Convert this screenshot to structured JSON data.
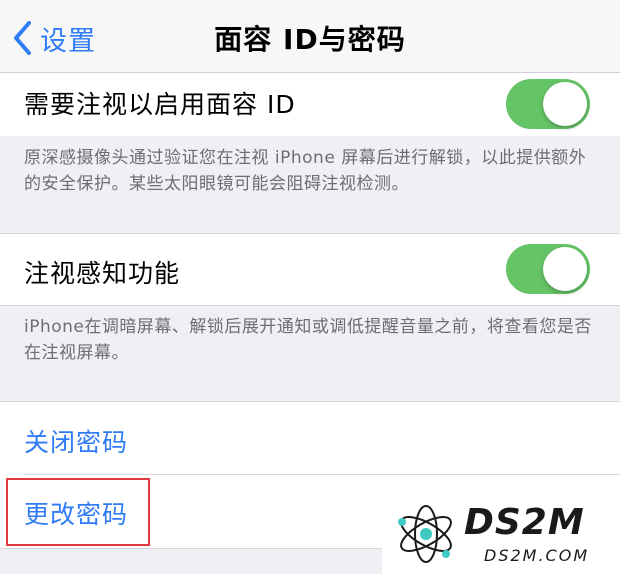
{
  "nav": {
    "back_label": "设置",
    "title": "面容 ID与密码"
  },
  "attention_row": {
    "label": "需要注视以启用面容 ID",
    "toggle_on": true,
    "footer": "原深感摄像头通过验证您在注视 iPhone 屏幕后进行解锁，以此提供额外的安全保护。某些太阳眼镜可能会阻碍注视检测。"
  },
  "aware_row": {
    "label": "注视感知功能",
    "toggle_on": true,
    "footer": "iPhone在调暗屏幕、解锁后展开通知或调低提醒音量之前，将查看您是否在注视屏幕。"
  },
  "passcode": {
    "turn_off": "关闭密码",
    "change": "更改密码"
  },
  "watermark": {
    "title": "DS2M",
    "subtitle": "DS2M.COM"
  },
  "colors": {
    "accent": "#2f7cf6",
    "toggle_on": "#65c466",
    "highlight": "#e0383e"
  }
}
